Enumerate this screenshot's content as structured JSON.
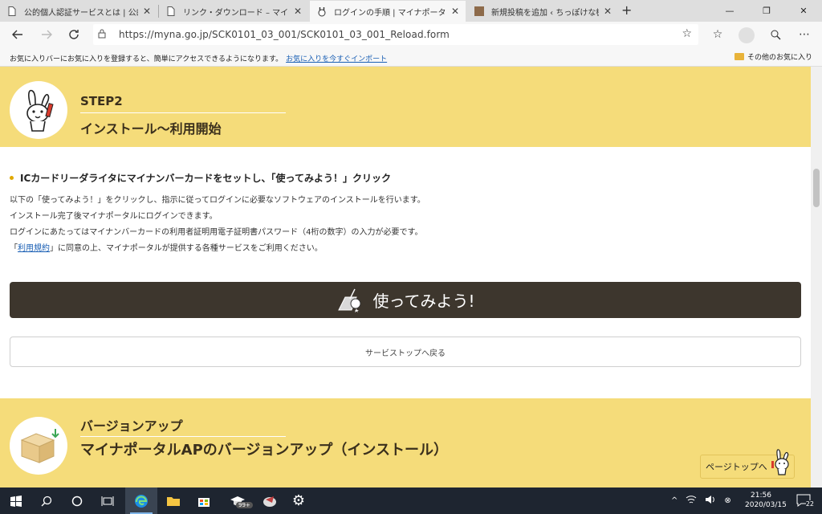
{
  "browser": {
    "tabs": [
      {
        "title": "公的個人認証サービスとは | 公的個…",
        "icon": "document-icon"
      },
      {
        "title": "リンク・ダウンロード – マイナンバーカード…",
        "icon": "document-icon"
      },
      {
        "title": "ログインの手順 | マイナポータル",
        "icon": "mynaportal-icon"
      },
      {
        "title": "新規投稿を追加 ‹ ちっぽけな機械の…",
        "icon": "wordpress-icon"
      }
    ],
    "url": "https://myna.go.jp/SCK0101_03_001/SCK0101_03_001_Reload.form",
    "favbar_message": "お気に入りバーにお気に入りを登録すると、簡単にアクセスできるようになります。",
    "favbar_link": "お気に入りを今すぐインポート",
    "other_favorites": "その他のお気に入り"
  },
  "step2": {
    "label": "STEP2",
    "title": "インストール～利用開始"
  },
  "instruction": {
    "heading": "ICカードリーダライタにマイナンバーカードをセットし、「使ってみよう！」クリック",
    "line1": "以下の「使ってみよう！」をクリックし、指示に従ってログインに必要なソフトウェアのインストールを行います。",
    "line2": "インストール完了後マイナポータルにログインできます。",
    "line3": "ログインにあたってはマイナンバーカードの利用者証明用電子証明書パスワード（4桁の数字）の入力が必要です。",
    "line4_prefix": "「",
    "terms_link": "利用規約",
    "line4_suffix": "」に同意の上、マイナポータルが提供する各種サービスをご利用ください。"
  },
  "buttons": {
    "use": "使ってみよう!",
    "back": "サービストップへ戻る",
    "pagetop": "ページトップへ"
  },
  "version": {
    "label": "バージョンアップ",
    "title": "マイナポータルAPのバージョンアップ（インストール）"
  },
  "taskbar": {
    "time": "21:56",
    "date": "2020/03/15",
    "badge": "99+",
    "notifications": "22"
  },
  "colors": {
    "band": "#f5dc7a",
    "use_button": "#3d362d",
    "link": "#1a5fb4"
  }
}
